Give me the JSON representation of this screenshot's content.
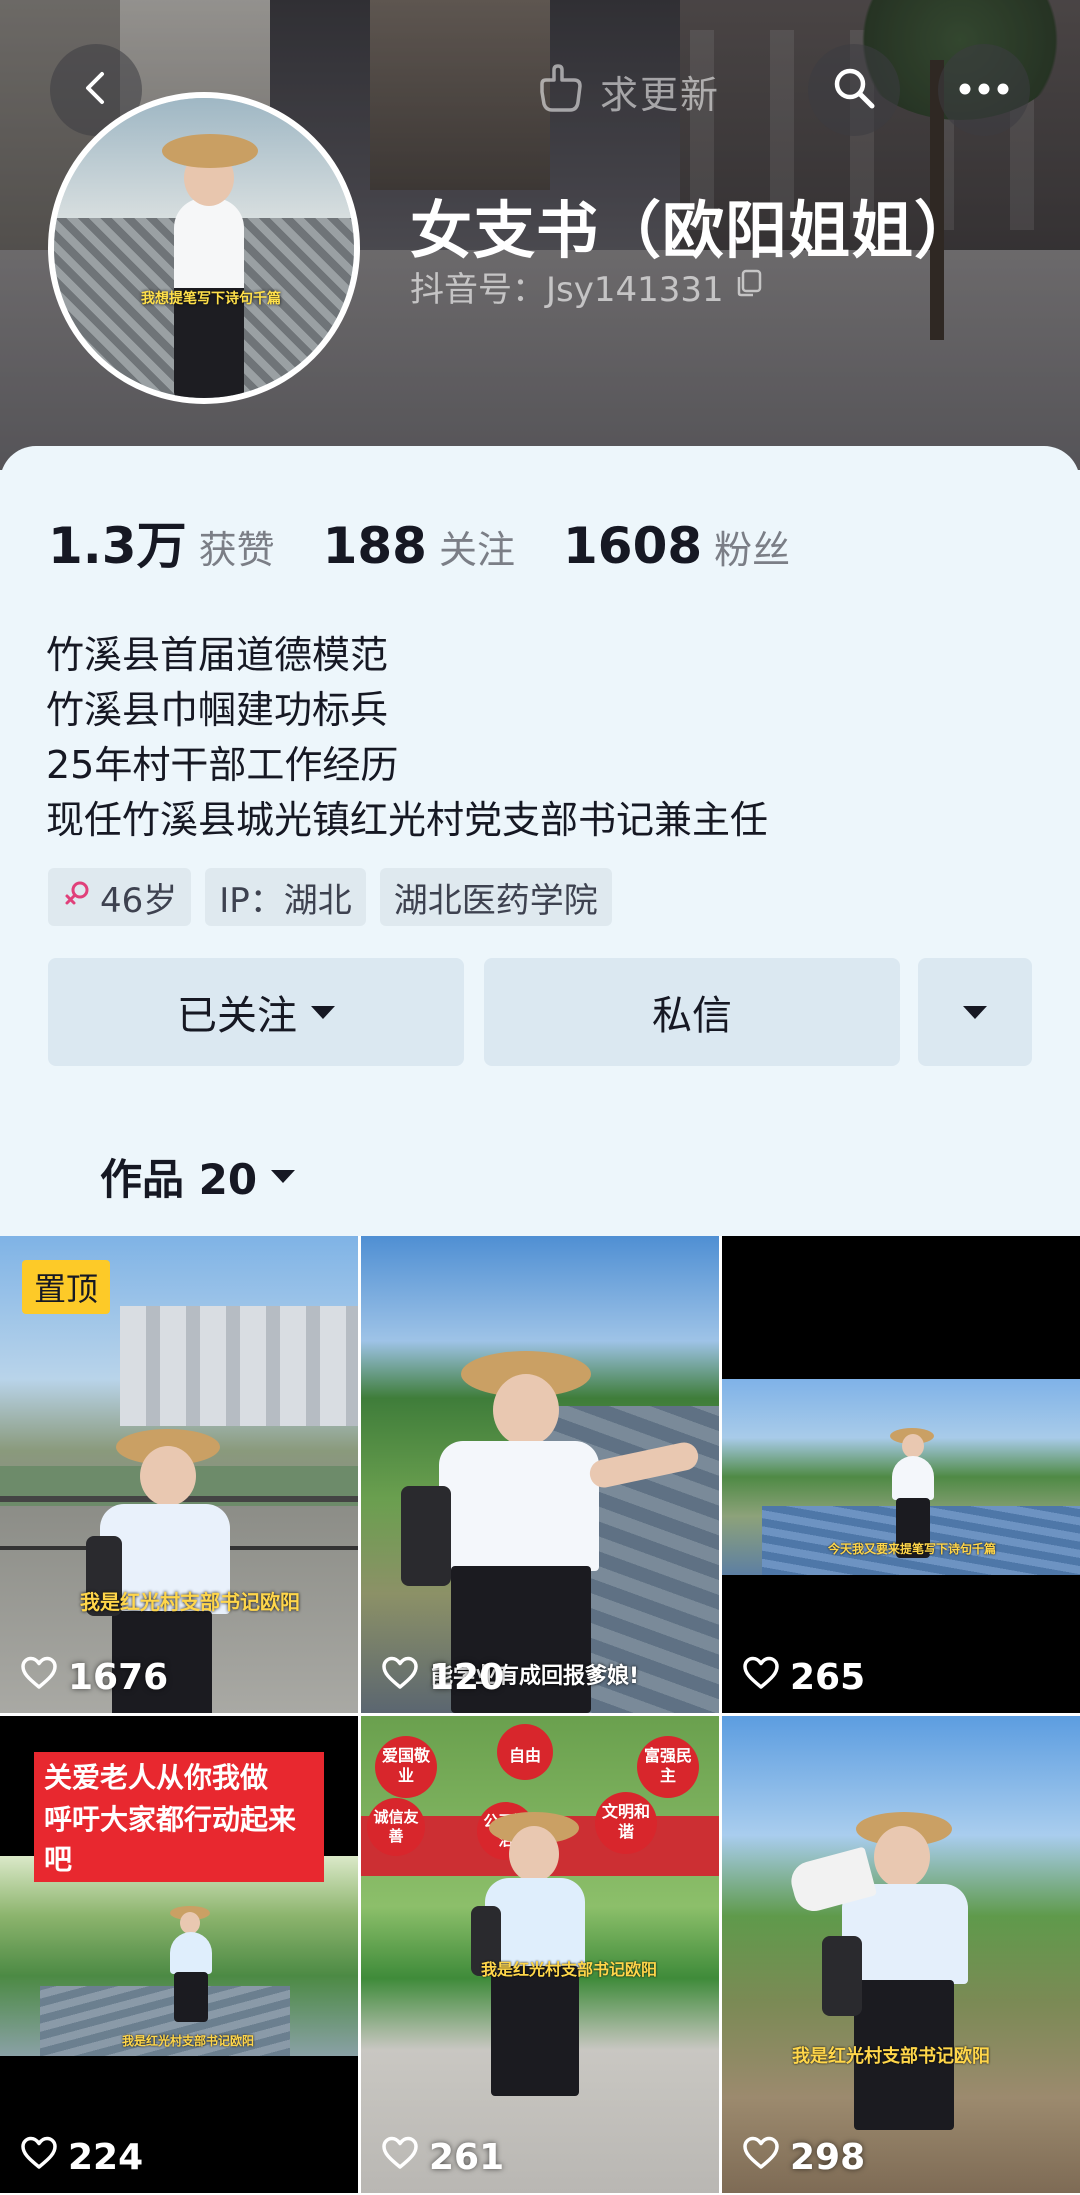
{
  "header": {
    "update_label": "求更新",
    "nickname": "女支书（欧阳姐姐）",
    "douyin_id": "抖音号：Jsy141331",
    "avatar_caption": "我想提笔写下诗句千篇"
  },
  "stats": [
    {
      "num": "1.3万",
      "label": "获赞"
    },
    {
      "num": "188",
      "label": "关注"
    },
    {
      "num": "1608",
      "label": "粉丝"
    }
  ],
  "bio": [
    "竹溪县首届道德模范",
    "竹溪县巾帼建功标兵",
    "25年村干部工作经历",
    "现任竹溪县城光镇红光村党支部书记兼主任"
  ],
  "tags": {
    "age": "46岁",
    "ip": "IP：湖北",
    "school": "湖北医药学院"
  },
  "actions": {
    "follow": "已关注",
    "message": "私信"
  },
  "works": {
    "label": "作品 20"
  },
  "videos": [
    {
      "likes": "1676",
      "pinned": "置顶",
      "caption": "我是红光村支部书记欧阳"
    },
    {
      "likes": "120",
      "caption": "能学业有成回报爹娘!"
    },
    {
      "likes": "265",
      "caption": "今天我又要来提笔写下诗句千篇"
    },
    {
      "likes": "224",
      "banner1": "关爱老人从你我做起！",
      "banner2": "呼吁大家都行动起来吧",
      "caption": "我是红光村支部书记欧阳"
    },
    {
      "likes": "261",
      "caption": "我是红光村支部书记欧阳",
      "signs": [
        "爱国敬业",
        "自由",
        "富强民主",
        "诚信友善",
        "公正法治",
        "文明和谐"
      ]
    },
    {
      "likes": "298",
      "caption": "我是红光村支部书记欧阳"
    }
  ],
  "colors": {
    "page_bg": "#edf6fb",
    "button_bg": "#dbe8f1",
    "pin_yellow": "#fdca28",
    "banner_red": "#e8282f",
    "female_pink": "#e0407a"
  }
}
